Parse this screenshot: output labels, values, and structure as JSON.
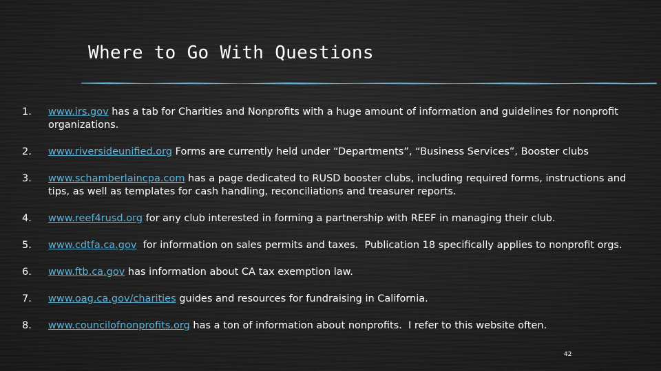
{
  "slide": {
    "title": "Where to Go With Questions",
    "page_number": "42",
    "accent_color": "#5fb3d9"
  },
  "items": [
    {
      "number": "1.",
      "link": "www.irs.gov",
      "text": " has a tab for Charities and Nonprofits with a huge amount of information and guidelines for nonprofit organizations."
    },
    {
      "number": "2.",
      "link": "www.riversideunified.org",
      "text": " Forms are currently held under “Departments”, “Business Services”, Booster clubs"
    },
    {
      "number": "3.",
      "link": "www.schamberlaincpa.com",
      "text": " has a page dedicated to RUSD booster clubs, including required forms, instructions and tips, as well as templates for cash handling, reconciliations and treasurer reports."
    },
    {
      "number": "4.",
      "link": "www.reef4rusd.org",
      "text": " for any club interested in forming a partnership with REEF in managing their club."
    },
    {
      "number": "5.",
      "link": "www.cdtfa.ca.gov",
      "text": "  for information on sales permits and taxes.  Publication 18 specifically applies to nonprofit orgs."
    },
    {
      "number": "6.",
      "link": "www.ftb.ca.gov",
      "text": " has information about CA tax exemption law."
    },
    {
      "number": "7.",
      "link": "www.oag.ca.gov/charities",
      "text": " guides and resources for fundraising in California."
    },
    {
      "number": "8.",
      "link": "www.councilofnonprofits.org",
      "text": " has a ton of information about nonprofits.  I refer to this website often."
    }
  ]
}
